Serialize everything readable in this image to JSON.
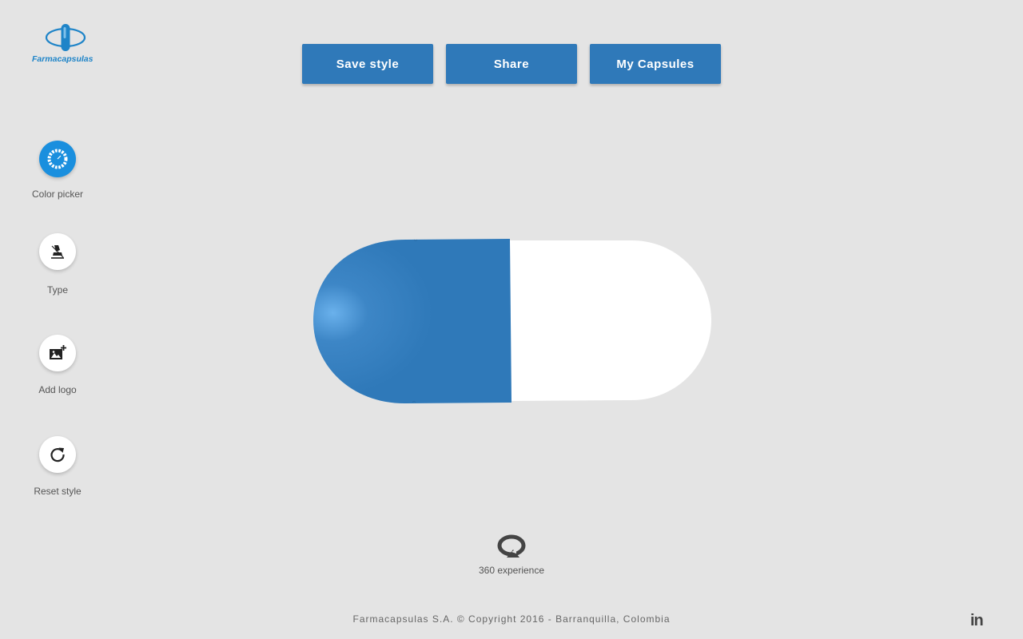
{
  "brand": {
    "name": "Farmacapsulas",
    "primary_color": "#2f79b9",
    "accent_color": "#1a8fde",
    "icon": "capsule-globe-icon"
  },
  "toolbar": {
    "save_label": "Save style",
    "share_label": "Share",
    "capsules_label": "My Capsules"
  },
  "tools": [
    {
      "label": "Color picker",
      "icon": "color-wheel-icon",
      "active": true
    },
    {
      "label": "Type",
      "icon": "type-stamp-icon",
      "active": false
    },
    {
      "label": "Add logo",
      "icon": "add-image-icon",
      "active": false
    },
    {
      "label": "Reset style",
      "icon": "reset-icon",
      "active": false
    }
  ],
  "capsule": {
    "cap_color": "#2f79b9",
    "body_color": "#ffffff"
  },
  "viewer": {
    "rotate_label": "360 experience",
    "icon": "rotate-360-icon"
  },
  "footer": {
    "copyright": "Farmacapsulas S.A. © Copyright 2016 - Barranquilla, Colombia",
    "social_icon": "linkedin-icon",
    "social_text": "in"
  }
}
